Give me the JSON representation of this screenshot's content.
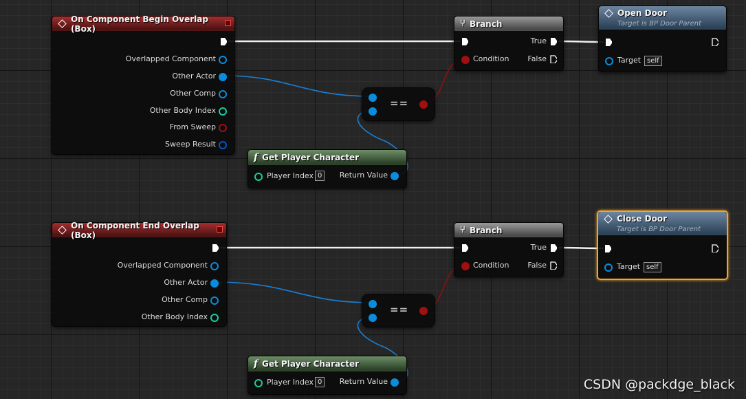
{
  "watermark": "CSDN @packdge_black",
  "colors": {
    "exec_wire": "#ffffff",
    "object_pin": "#0a8dde",
    "bool_pin": "#a01010",
    "int_pin": "#1dcd9f",
    "struct_pin": "#0057c8",
    "selected_outline": "#f3a628"
  },
  "begin_overlap": {
    "title": "On Component Begin Overlap (Box)",
    "pins": [
      "Overlapped Component",
      "Other Actor",
      "Other Comp",
      "Other Body Index",
      "From Sweep",
      "Sweep Result"
    ]
  },
  "end_overlap": {
    "title": "On Component End Overlap (Box)",
    "pins": [
      "Overlapped Component",
      "Other Actor",
      "Other Comp",
      "Other Body Index"
    ]
  },
  "branch_1": {
    "title": "Branch",
    "condition": "Condition",
    "true": "True",
    "false": "False"
  },
  "branch_2": {
    "title": "Branch",
    "condition": "Condition",
    "true": "True",
    "false": "False"
  },
  "open_door": {
    "title": "Open Door",
    "subtitle": "Target is BP Door Parent",
    "target": "Target",
    "target_value": "self"
  },
  "close_door": {
    "title": "Close Door",
    "subtitle": "Target is BP Door Parent",
    "target": "Target",
    "target_value": "self"
  },
  "get_player_1": {
    "title": "Get Player Character",
    "player_index": "Player Index",
    "index_value": "0",
    "return_value": "Return Value"
  },
  "get_player_2": {
    "title": "Get Player Character",
    "player_index": "Player Index",
    "index_value": "0",
    "return_value": "Return Value"
  },
  "equal_1": {
    "label": "=="
  },
  "equal_2": {
    "label": "=="
  }
}
